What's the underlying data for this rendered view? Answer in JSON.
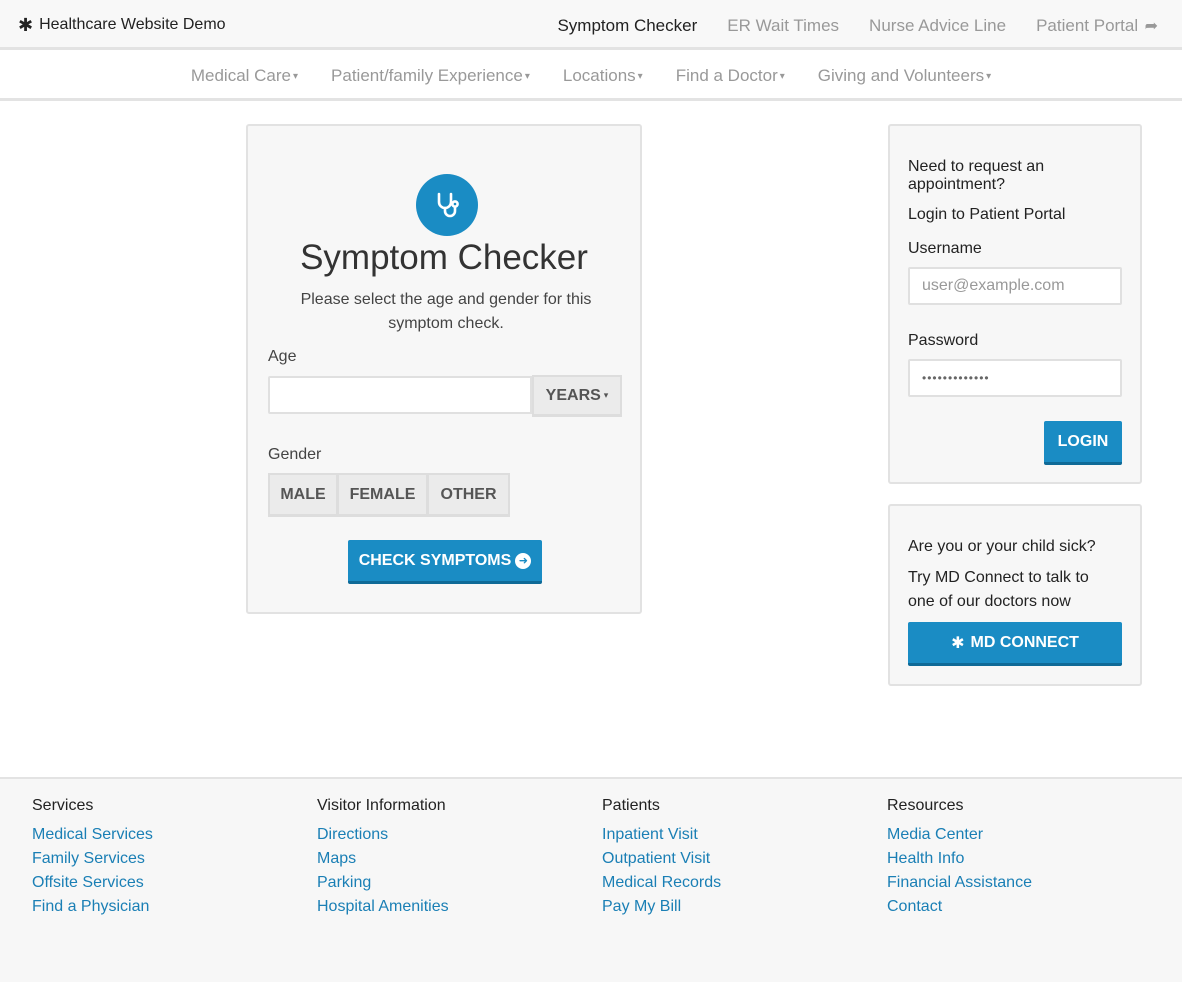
{
  "brand": {
    "icon": "asterisk-icon",
    "title": "Healthcare Website Demo"
  },
  "top_links": [
    {
      "label": "Symptom Checker"
    },
    {
      "label": "ER Wait Times"
    },
    {
      "label": "Nurse Advice Line"
    },
    {
      "label": "Patient Portal",
      "icon": "share-icon"
    }
  ],
  "sub_nav": [
    {
      "label": "Medical Care"
    },
    {
      "label": "Patient/family Experience"
    },
    {
      "label": "Locations"
    },
    {
      "label": "Find a Doctor"
    },
    {
      "label": "Giving and Volunteers"
    }
  ],
  "symptom_checker": {
    "icon": "stethoscope-icon",
    "title": "Symptom Checker",
    "subtitle": "Please select the age and gender for this symptom check.",
    "age_label": "Age",
    "age_value": "",
    "age_unit": "YEARS",
    "gender_label": "Gender",
    "genders": [
      "MALE",
      "FEMALE",
      "OTHER"
    ],
    "check_button": "CHECK SYMPTOMS"
  },
  "login": {
    "question": "Need to request an appointment?",
    "portal_text": "Login to Patient Portal",
    "username_label": "Username",
    "username_placeholder": "user@example.com",
    "password_label": "Password",
    "password_value": "•••••••••••••",
    "button": "LOGIN"
  },
  "md_connect": {
    "question": "Are you or your child sick?",
    "text": "Try MD Connect to talk to one of our doctors now",
    "button": "MD CONNECT"
  },
  "footer": {
    "columns": [
      {
        "title": "Services",
        "links": [
          "Medical Services",
          "Family Services",
          "Offsite Services",
          "Find a Physician"
        ]
      },
      {
        "title": "Visitor Information",
        "links": [
          "Directions",
          "Maps",
          "Parking",
          "Hospital Amenities"
        ]
      },
      {
        "title": "Patients",
        "links": [
          "Inpatient Visit",
          "Outpatient Visit",
          "Medical Records",
          "Pay My Bill"
        ]
      },
      {
        "title": "Resources",
        "links": [
          "Media Center",
          "Health Info",
          "Financial Assistance",
          "Contact"
        ]
      }
    ]
  },
  "colors": {
    "accent": "#1a8cc4",
    "link": "#1a7fb5"
  }
}
